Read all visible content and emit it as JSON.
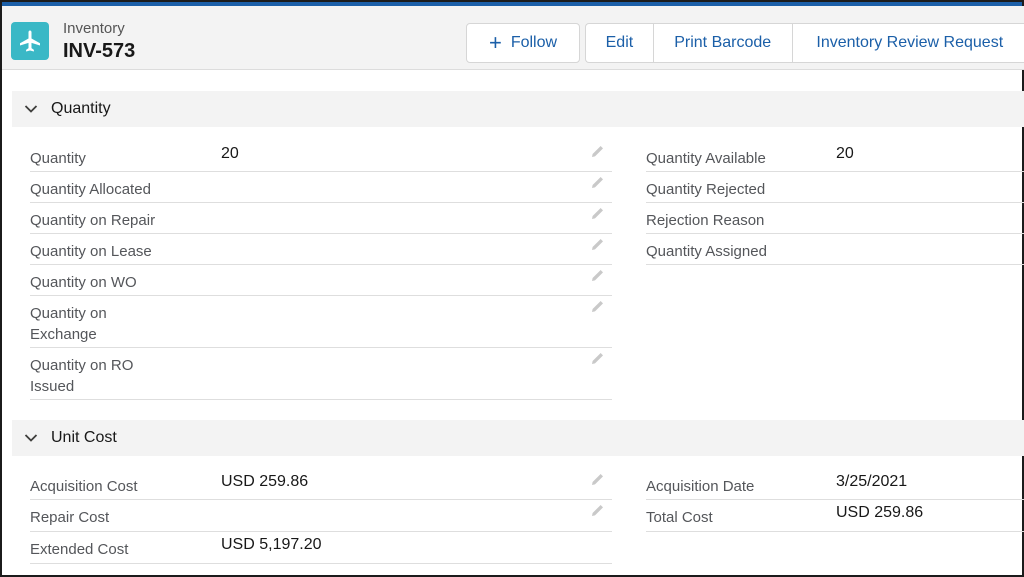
{
  "header": {
    "object_label": "Inventory",
    "record_title": "INV-573",
    "app_icon": "airplane-icon",
    "follow_label": "Follow",
    "edit_label": "Edit",
    "print_barcode_label": "Print Barcode",
    "review_request_label": "Inventory Review Request"
  },
  "sections": {
    "quantity": {
      "title": "Quantity",
      "left": [
        {
          "label": "Quantity",
          "value": "20"
        },
        {
          "label": "Quantity Allocated",
          "value": ""
        },
        {
          "label": "Quantity on Repair",
          "value": ""
        },
        {
          "label": "Quantity on Lease",
          "value": ""
        },
        {
          "label": "Quantity on WO",
          "value": ""
        },
        {
          "label": "Quantity on Exchange",
          "value": ""
        },
        {
          "label": "Quantity on RO Issued",
          "value": ""
        }
      ],
      "right": [
        {
          "label": "Quantity Available",
          "value": "20"
        },
        {
          "label": "Quantity Rejected",
          "value": ""
        },
        {
          "label": "Rejection Reason",
          "value": ""
        },
        {
          "label": "Quantity Assigned",
          "value": ""
        }
      ]
    },
    "unit_cost": {
      "title": "Unit Cost",
      "left": [
        {
          "label": "Acquisition Cost",
          "value": "USD 259.86"
        },
        {
          "label": "Repair Cost",
          "value": ""
        },
        {
          "label": "Extended Cost",
          "value": "USD 5,197.20"
        }
      ],
      "right": [
        {
          "label": "Acquisition Date",
          "value": "3/25/2021"
        },
        {
          "label": "Total Cost",
          "value": "USD 259.86"
        }
      ]
    }
  },
  "colors": {
    "accent": "#1b5fa8",
    "app_icon_bg": "#3ab8c6"
  }
}
